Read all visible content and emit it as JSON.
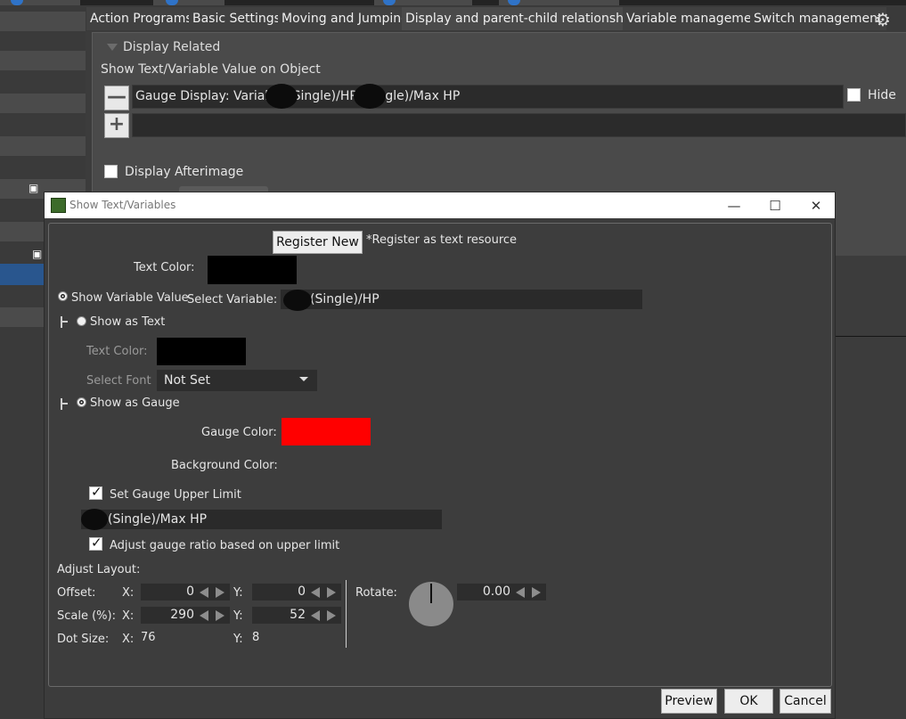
{
  "editor": {
    "tabs": [
      "Action Programs",
      "Basic Settings",
      "Moving and Jumping",
      "Display and parent-child relationship",
      "Variable management",
      "Switch management"
    ],
    "section_title": "Display Related",
    "subtitle": "Show Text/Variable Value on Object",
    "row_value": "Gauge Display: Variable (Single)/HP (Single)/Max HP",
    "hide_label": "Hide",
    "afterimage_label": "Display Afterimage"
  },
  "dialog": {
    "title": "Show Text/Variables",
    "register_new": "Register New",
    "register_note": "*Register as text resource",
    "text_color_label": "Text Color:",
    "show_variable_value": "Show Variable Value",
    "select_variable_label": "Select Variable:",
    "selected_variable": "(Single)/HP",
    "show_as_text": "Show as Text",
    "text_color_label_2": "Text Color:",
    "select_font_label": "Select Font",
    "font_value": "Not Set",
    "show_as_gauge": "Show as Gauge",
    "gauge_color_label": "Gauge Color:",
    "gauge_color": "#ff0000",
    "background_color_label": "Background Color:",
    "set_upper_limit": "Set Gauge Upper Limit",
    "upper_limit_variable": "(Single)/Max HP",
    "adjust_ratio": "Adjust gauge ratio based on upper limit",
    "adjust_layout": "Adjust Layout:",
    "offset_label": "Offset:",
    "scale_label": "Scale (%):",
    "dot_size_label": "Dot Size:",
    "x_label": "X:",
    "y_label": "Y:",
    "offset_x": "0",
    "offset_y": "0",
    "scale_x": "290",
    "scale_y": "52",
    "dot_x": "76",
    "dot_y": "8",
    "rotate_label": "Rotate:",
    "rotate_value": "0.00",
    "preview": "Preview",
    "ok": "OK",
    "cancel": "Cancel"
  },
  "icons": [
    "gear-icon",
    "minus-icon",
    "plus-icon",
    "minimize-icon",
    "maximize-icon",
    "close-icon",
    "app-icon"
  ]
}
